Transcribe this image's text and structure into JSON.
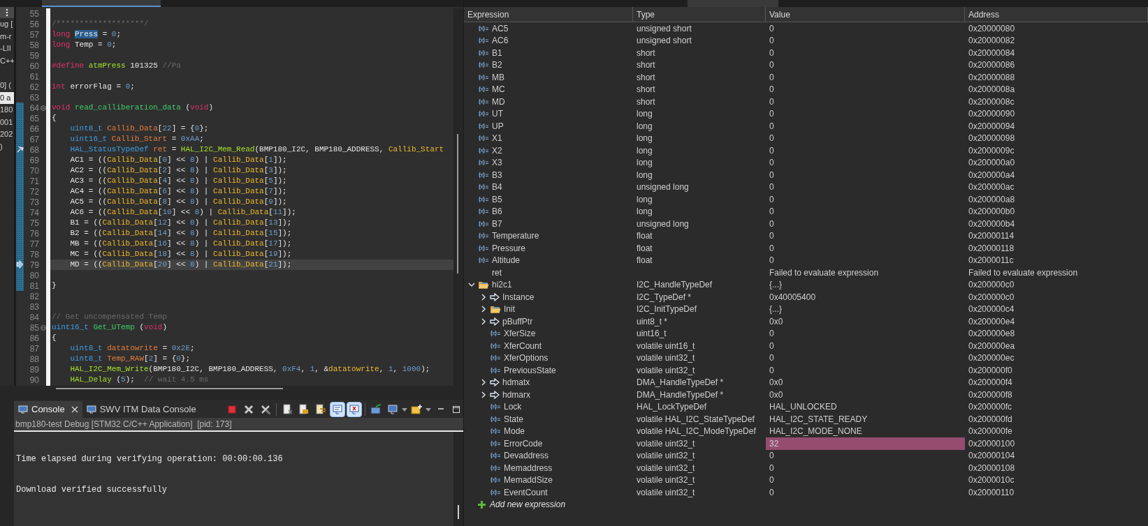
{
  "left_panel": {
    "fragments": [
      {
        "text": "ug [",
        "selected": false
      },
      {
        "text": "m-r",
        "selected": false
      },
      {
        "text": "-LII",
        "selected": false
      },
      {
        "text": "C++",
        "selected": false
      },
      {
        "text": "0] (",
        "selected": false
      },
      {
        "text": "0 a",
        "selected": true
      },
      {
        "text": "180",
        "selected": false
      },
      {
        "text": "001",
        "selected": false
      },
      {
        "text": "202",
        "selected": false
      },
      {
        "text": ")",
        "selected": false
      }
    ]
  },
  "editor": {
    "lines": [
      {
        "number": "55",
        "kind": "code",
        "current": false,
        "ranged": false,
        "foldable": false,
        "indented": false
      },
      {
        "number": "56",
        "kind": "code",
        "current": false,
        "ranged": false,
        "foldable": false,
        "indented": false,
        "tokens": [
          {
            "kind": "comment",
            "text": "/*******************/"
          }
        ]
      },
      {
        "number": "57",
        "kind": "code",
        "current": false,
        "ranged": false,
        "foldable": false,
        "indented": false,
        "tokens": [
          {
            "kind": "kw",
            "text": "long "
          },
          {
            "kind": "sel",
            "text": "Press"
          },
          {
            "kind": "plain",
            "text": " = "
          },
          {
            "kind": "num",
            "text": "0"
          },
          {
            "kind": "plain",
            "text": ";"
          }
        ]
      },
      {
        "number": "58",
        "kind": "code",
        "current": false,
        "ranged": false,
        "foldable": false,
        "indented": false,
        "tokens": [
          {
            "kind": "kw",
            "text": "long"
          },
          {
            "kind": "plain",
            "text": " Temp = "
          },
          {
            "kind": "num",
            "text": "0"
          },
          {
            "kind": "plain",
            "text": ";"
          }
        ]
      },
      {
        "number": "59",
        "kind": "code",
        "current": false,
        "ranged": false,
        "foldable": false,
        "indented": false
      },
      {
        "number": "60",
        "kind": "code",
        "current": false,
        "ranged": false,
        "foldable": false,
        "indented": false,
        "tokens": [
          {
            "kind": "kw",
            "text": "#define "
          },
          {
            "kind": "macro",
            "text": "atmPress"
          },
          {
            "kind": "plain",
            "text": " 101325 "
          },
          {
            "kind": "comment",
            "text": "//Pa"
          }
        ]
      },
      {
        "number": "61",
        "kind": "code",
        "current": false,
        "ranged": false,
        "foldable": false,
        "indented": false
      },
      {
        "number": "62",
        "kind": "code",
        "current": false,
        "ranged": false,
        "foldable": false,
        "indented": false,
        "tokens": [
          {
            "kind": "kw",
            "text": "int"
          },
          {
            "kind": "plain",
            "text": " errorFlag = "
          },
          {
            "kind": "num",
            "text": "0"
          },
          {
            "kind": "plain",
            "text": ";"
          }
        ]
      },
      {
        "number": "63",
        "kind": "code",
        "current": false,
        "ranged": false,
        "foldable": false,
        "indented": false
      },
      {
        "number": "64",
        "kind": "code",
        "current": false,
        "ranged": true,
        "foldable": true,
        "indented": false,
        "tokens": [
          {
            "kind": "kw",
            "text": "void "
          },
          {
            "kind": "fdecl",
            "text": "read_calliberation_data"
          },
          {
            "kind": "plain",
            "text": " ("
          },
          {
            "kind": "kw",
            "text": "void"
          },
          {
            "kind": "plain",
            "text": ")"
          }
        ]
      },
      {
        "number": "65",
        "kind": "code",
        "current": false,
        "ranged": true,
        "foldable": false,
        "indented": false,
        "tokens": [
          {
            "kind": "plain",
            "text": "{"
          }
        ]
      },
      {
        "number": "66",
        "kind": "code",
        "current": false,
        "ranged": true,
        "foldable": false,
        "indented": true,
        "tokens": [
          {
            "kind": "type",
            "text": "uint8_t "
          },
          {
            "kind": "local",
            "text": "Callib_Data"
          },
          {
            "kind": "plain",
            "text": "["
          },
          {
            "kind": "num",
            "text": "22"
          },
          {
            "kind": "plain",
            "text": "] = {"
          },
          {
            "kind": "num",
            "text": "0"
          },
          {
            "kind": "plain",
            "text": "};"
          }
        ]
      },
      {
        "number": "67",
        "kind": "code",
        "current": false,
        "ranged": true,
        "foldable": false,
        "indented": true,
        "tokens": [
          {
            "kind": "type",
            "text": "uint16_t "
          },
          {
            "kind": "local",
            "text": "Callib_Start"
          },
          {
            "kind": "plain",
            "text": " = "
          },
          {
            "kind": "num",
            "text": "0xAA"
          },
          {
            "kind": "plain",
            "text": ";"
          }
        ]
      },
      {
        "number": "68",
        "kind": "breakpoint",
        "current": false,
        "ranged": true,
        "foldable": false,
        "indented": true,
        "tokens": [
          {
            "kind": "type",
            "text": "HAL_StatusTypeDef "
          },
          {
            "kind": "local",
            "text": "ret"
          },
          {
            "kind": "plain",
            "text": " = "
          },
          {
            "kind": "func",
            "text": "HAL_I2C_Mem_Read"
          },
          {
            "kind": "plain",
            "text": "(BMP180_I2C, BMP180_ADDRESS, "
          },
          {
            "kind": "var",
            "text": "Callib_Start"
          }
        ]
      },
      {
        "number": "69",
        "kind": "code",
        "current": false,
        "ranged": true,
        "foldable": false,
        "indented": true,
        "tokens": [
          {
            "kind": "plain",
            "text": "AC1 = (("
          },
          {
            "kind": "var",
            "text": "Callib_Data"
          },
          {
            "kind": "plain",
            "text": "["
          },
          {
            "kind": "num",
            "text": "0"
          },
          {
            "kind": "plain",
            "text": "] << "
          },
          {
            "kind": "num",
            "text": "8"
          },
          {
            "kind": "plain",
            "text": ") | "
          },
          {
            "kind": "var",
            "text": "Callib_Data"
          },
          {
            "kind": "plain",
            "text": "["
          },
          {
            "kind": "num",
            "text": "1"
          },
          {
            "kind": "plain",
            "text": "]);"
          }
        ]
      },
      {
        "number": "70",
        "kind": "code",
        "current": false,
        "ranged": true,
        "foldable": false,
        "indented": true,
        "tokens": [
          {
            "kind": "plain",
            "text": "AC2 = (("
          },
          {
            "kind": "var",
            "text": "Callib_Data"
          },
          {
            "kind": "plain",
            "text": "["
          },
          {
            "kind": "num",
            "text": "2"
          },
          {
            "kind": "plain",
            "text": "] << "
          },
          {
            "kind": "num",
            "text": "8"
          },
          {
            "kind": "plain",
            "text": ") | "
          },
          {
            "kind": "var",
            "text": "Callib_Data"
          },
          {
            "kind": "plain",
            "text": "["
          },
          {
            "kind": "num",
            "text": "3"
          },
          {
            "kind": "plain",
            "text": "]);"
          }
        ]
      },
      {
        "number": "71",
        "kind": "code",
        "current": false,
        "ranged": true,
        "foldable": false,
        "indented": true,
        "tokens": [
          {
            "kind": "plain",
            "text": "AC3 = (("
          },
          {
            "kind": "var",
            "text": "Callib_Data"
          },
          {
            "kind": "plain",
            "text": "["
          },
          {
            "kind": "num",
            "text": "4"
          },
          {
            "kind": "plain",
            "text": "] << "
          },
          {
            "kind": "num",
            "text": "8"
          },
          {
            "kind": "plain",
            "text": ") | "
          },
          {
            "kind": "var",
            "text": "Callib_Data"
          },
          {
            "kind": "plain",
            "text": "["
          },
          {
            "kind": "num",
            "text": "5"
          },
          {
            "kind": "plain",
            "text": "]);"
          }
        ]
      },
      {
        "number": "72",
        "kind": "code",
        "current": false,
        "ranged": true,
        "foldable": false,
        "indented": true,
        "tokens": [
          {
            "kind": "plain",
            "text": "AC4 = (("
          },
          {
            "kind": "var",
            "text": "Callib_Data"
          },
          {
            "kind": "plain",
            "text": "["
          },
          {
            "kind": "num",
            "text": "6"
          },
          {
            "kind": "plain",
            "text": "] << "
          },
          {
            "kind": "num",
            "text": "8"
          },
          {
            "kind": "plain",
            "text": ") | "
          },
          {
            "kind": "var",
            "text": "Callib_Data"
          },
          {
            "kind": "plain",
            "text": "["
          },
          {
            "kind": "num",
            "text": "7"
          },
          {
            "kind": "plain",
            "text": "]);"
          }
        ]
      },
      {
        "number": "73",
        "kind": "code",
        "current": false,
        "ranged": true,
        "foldable": false,
        "indented": true,
        "tokens": [
          {
            "kind": "plain",
            "text": "AC5 = (("
          },
          {
            "kind": "var",
            "text": "Callib_Data"
          },
          {
            "kind": "plain",
            "text": "["
          },
          {
            "kind": "num",
            "text": "8"
          },
          {
            "kind": "plain",
            "text": "] << "
          },
          {
            "kind": "num",
            "text": "8"
          },
          {
            "kind": "plain",
            "text": ") | "
          },
          {
            "kind": "var",
            "text": "Callib_Data"
          },
          {
            "kind": "plain",
            "text": "["
          },
          {
            "kind": "num",
            "text": "9"
          },
          {
            "kind": "plain",
            "text": "]);"
          }
        ]
      },
      {
        "number": "74",
        "kind": "code",
        "current": false,
        "ranged": true,
        "foldable": false,
        "indented": true,
        "tokens": [
          {
            "kind": "plain",
            "text": "AC6 = (("
          },
          {
            "kind": "var",
            "text": "Callib_Data"
          },
          {
            "kind": "plain",
            "text": "["
          },
          {
            "kind": "num",
            "text": "10"
          },
          {
            "kind": "plain",
            "text": "] << "
          },
          {
            "kind": "num",
            "text": "8"
          },
          {
            "kind": "plain",
            "text": ") | "
          },
          {
            "kind": "var",
            "text": "Callib_Data"
          },
          {
            "kind": "plain",
            "text": "["
          },
          {
            "kind": "num",
            "text": "11"
          },
          {
            "kind": "plain",
            "text": "]);"
          }
        ]
      },
      {
        "number": "75",
        "kind": "code",
        "current": false,
        "ranged": true,
        "foldable": false,
        "indented": true,
        "tokens": [
          {
            "kind": "plain",
            "text": "B1 = (("
          },
          {
            "kind": "var",
            "text": "Callib_Data"
          },
          {
            "kind": "plain",
            "text": "["
          },
          {
            "kind": "num",
            "text": "12"
          },
          {
            "kind": "plain",
            "text": "] << "
          },
          {
            "kind": "num",
            "text": "8"
          },
          {
            "kind": "plain",
            "text": ") | "
          },
          {
            "kind": "var",
            "text": "Callib_Data"
          },
          {
            "kind": "plain",
            "text": "["
          },
          {
            "kind": "num",
            "text": "13"
          },
          {
            "kind": "plain",
            "text": "]);"
          }
        ]
      },
      {
        "number": "76",
        "kind": "code",
        "current": false,
        "ranged": true,
        "foldable": false,
        "indented": true,
        "tokens": [
          {
            "kind": "plain",
            "text": "B2 = (("
          },
          {
            "kind": "var",
            "text": "Callib_Data"
          },
          {
            "kind": "plain",
            "text": "["
          },
          {
            "kind": "num",
            "text": "14"
          },
          {
            "kind": "plain",
            "text": "] << "
          },
          {
            "kind": "num",
            "text": "8"
          },
          {
            "kind": "plain",
            "text": ") | "
          },
          {
            "kind": "var",
            "text": "Callib_Data"
          },
          {
            "kind": "plain",
            "text": "["
          },
          {
            "kind": "num",
            "text": "15"
          },
          {
            "kind": "plain",
            "text": "]);"
          }
        ]
      },
      {
        "number": "77",
        "kind": "code",
        "current": false,
        "ranged": true,
        "foldable": false,
        "indented": true,
        "tokens": [
          {
            "kind": "plain",
            "text": "MB = (("
          },
          {
            "kind": "var",
            "text": "Callib_Data"
          },
          {
            "kind": "plain",
            "text": "["
          },
          {
            "kind": "num",
            "text": "16"
          },
          {
            "kind": "plain",
            "text": "] << "
          },
          {
            "kind": "num",
            "text": "8"
          },
          {
            "kind": "plain",
            "text": ") | "
          },
          {
            "kind": "var",
            "text": "Callib_Data"
          },
          {
            "kind": "plain",
            "text": "["
          },
          {
            "kind": "num",
            "text": "17"
          },
          {
            "kind": "plain",
            "text": "]);"
          }
        ]
      },
      {
        "number": "78",
        "kind": "code",
        "current": false,
        "ranged": true,
        "foldable": false,
        "indented": true,
        "tokens": [
          {
            "kind": "plain",
            "text": "MC = (("
          },
          {
            "kind": "var",
            "text": "Callib_Data"
          },
          {
            "kind": "plain",
            "text": "["
          },
          {
            "kind": "num",
            "text": "18"
          },
          {
            "kind": "plain",
            "text": "] << "
          },
          {
            "kind": "num",
            "text": "8"
          },
          {
            "kind": "plain",
            "text": ") | "
          },
          {
            "kind": "var",
            "text": "Callib_Data"
          },
          {
            "kind": "plain",
            "text": "["
          },
          {
            "kind": "num",
            "text": "19"
          },
          {
            "kind": "plain",
            "text": "]);"
          }
        ]
      },
      {
        "number": "79",
        "kind": "pointer",
        "current": true,
        "ranged": true,
        "foldable": false,
        "indented": true,
        "tokens": [
          {
            "kind": "plain",
            "text": "MD = (("
          },
          {
            "kind": "var",
            "text": "Callib_Data"
          },
          {
            "kind": "plain",
            "text": "["
          },
          {
            "kind": "num",
            "text": "20"
          },
          {
            "kind": "plain",
            "text": "] << "
          },
          {
            "kind": "num",
            "text": "8"
          },
          {
            "kind": "plain",
            "text": ") | "
          },
          {
            "kind": "var",
            "text": "Callib_Data"
          },
          {
            "kind": "plain",
            "text": "["
          },
          {
            "kind": "num",
            "text": "21"
          },
          {
            "kind": "plain",
            "text": "]);"
          }
        ]
      },
      {
        "number": "80",
        "kind": "code",
        "current": false,
        "ranged": true,
        "foldable": false,
        "indented": false
      },
      {
        "number": "81",
        "kind": "code",
        "current": false,
        "ranged": true,
        "foldable": false,
        "indented": false,
        "tokens": [
          {
            "kind": "plain",
            "text": "}"
          }
        ]
      },
      {
        "number": "82",
        "kind": "code",
        "current": false,
        "ranged": false,
        "foldable": false,
        "indented": false
      },
      {
        "number": "83",
        "kind": "code",
        "current": false,
        "ranged": false,
        "foldable": false,
        "indented": false
      },
      {
        "number": "84",
        "kind": "code",
        "current": false,
        "ranged": false,
        "foldable": false,
        "indented": false,
        "tokens": [
          {
            "kind": "comment",
            "text": "// Get uncompensated Temp"
          }
        ]
      },
      {
        "number": "85",
        "kind": "code",
        "current": false,
        "ranged": false,
        "foldable": true,
        "indented": false,
        "tokens": [
          {
            "kind": "type",
            "text": "uint16_t "
          },
          {
            "kind": "fdecl",
            "text": "Get_UTemp"
          },
          {
            "kind": "plain",
            "text": " ("
          },
          {
            "kind": "kw",
            "text": "void"
          },
          {
            "kind": "plain",
            "text": ")"
          }
        ]
      },
      {
        "number": "86",
        "kind": "code",
        "current": false,
        "ranged": false,
        "foldable": false,
        "indented": false,
        "tokens": [
          {
            "kind": "plain",
            "text": "{"
          }
        ]
      },
      {
        "number": "87",
        "kind": "code",
        "current": false,
        "ranged": false,
        "foldable": false,
        "indented": true,
        "tokens": [
          {
            "kind": "type",
            "text": "uint8_t "
          },
          {
            "kind": "local",
            "text": "datatowrite"
          },
          {
            "kind": "plain",
            "text": " = "
          },
          {
            "kind": "num",
            "text": "0x2E"
          },
          {
            "kind": "plain",
            "text": ";"
          }
        ]
      },
      {
        "number": "88",
        "kind": "code",
        "current": false,
        "ranged": false,
        "foldable": false,
        "indented": true,
        "tokens": [
          {
            "kind": "type",
            "text": "uint8_t "
          },
          {
            "kind": "local",
            "text": "Temp_RAW"
          },
          {
            "kind": "plain",
            "text": "["
          },
          {
            "kind": "num",
            "text": "2"
          },
          {
            "kind": "plain",
            "text": "] = {"
          },
          {
            "kind": "num",
            "text": "0"
          },
          {
            "kind": "plain",
            "text": "};"
          }
        ]
      },
      {
        "number": "89",
        "kind": "code",
        "current": false,
        "ranged": false,
        "foldable": false,
        "indented": true,
        "tokens": [
          {
            "kind": "func",
            "text": "HAL_I2C_Mem_Write"
          },
          {
            "kind": "plain",
            "text": "(BMP180_I2C, BMP180_ADDRESS, "
          },
          {
            "kind": "num",
            "text": "0xF4"
          },
          {
            "kind": "plain",
            "text": ", "
          },
          {
            "kind": "num",
            "text": "1"
          },
          {
            "kind": "plain",
            "text": ", &"
          },
          {
            "kind": "var",
            "text": "datatowrite"
          },
          {
            "kind": "plain",
            "text": ", "
          },
          {
            "kind": "num",
            "text": "1"
          },
          {
            "kind": "plain",
            "text": ", "
          },
          {
            "kind": "num",
            "text": "1000"
          },
          {
            "kind": "plain",
            "text": ");"
          }
        ]
      },
      {
        "number": "90",
        "kind": "code",
        "current": false,
        "ranged": false,
        "foldable": false,
        "indented": true,
        "tokens": [
          {
            "kind": "func",
            "text": "HAL_Delay"
          },
          {
            "kind": "plain",
            "text": " ("
          },
          {
            "kind": "num",
            "text": "5"
          },
          {
            "kind": "plain",
            "text": ");  "
          },
          {
            "kind": "comment",
            "text": "// wait 4.5 ms"
          }
        ]
      }
    ]
  },
  "console": {
    "tabs": [
      {
        "label": "Console",
        "selected": true
      },
      {
        "label": "SWV ITM Data Console",
        "selected": false
      }
    ],
    "toolbar": [
      {
        "kind": "terminate",
        "on": false
      },
      {
        "kind": "remove",
        "on": false
      },
      {
        "kind": "remove-all",
        "on": false
      },
      {
        "kind": "clear",
        "on": false
      },
      {
        "kind": "scroll-lock",
        "on": false
      },
      {
        "kind": "word-wrap",
        "on": false
      },
      {
        "kind": "show-stdout",
        "on": true
      },
      {
        "kind": "show-stderr",
        "on": true
      },
      {
        "kind": "pin",
        "on": false
      },
      {
        "kind": "display",
        "on": false
      },
      {
        "kind": "new-console",
        "on": false
      }
    ],
    "launch": "bmp180-test Debug [STM32 C/C++ Application]  [pid: 173]",
    "lines": [
      "Time elapsed during verifying operation: 00:00:00.136",
      "Download verified successfully"
    ]
  },
  "expressions": {
    "columns": [
      "Expression",
      "Type",
      "Value",
      "Address"
    ],
    "rows": [
      {
        "expression": "AC5",
        "type": "unsigned short",
        "value": "0",
        "address": "0x20000080",
        "kind": "variable",
        "changed": false
      },
      {
        "expression": "AC6",
        "type": "unsigned short",
        "value": "0",
        "address": "0x20000082",
        "kind": "variable",
        "changed": false
      },
      {
        "expression": "B1",
        "type": "short",
        "value": "0",
        "address": "0x20000084",
        "kind": "variable",
        "changed": false
      },
      {
        "expression": "B2",
        "type": "short",
        "value": "0",
        "address": "0x20000086",
        "kind": "variable",
        "changed": false
      },
      {
        "expression": "MB",
        "type": "short",
        "value": "0",
        "address": "0x20000088",
        "kind": "variable",
        "changed": false
      },
      {
        "expression": "MC",
        "type": "short",
        "value": "0",
        "address": "0x2000008a",
        "kind": "variable",
        "changed": false
      },
      {
        "expression": "MD",
        "type": "short",
        "value": "0",
        "address": "0x2000008c",
        "kind": "variable",
        "changed": false
      },
      {
        "expression": "UT",
        "type": "long",
        "value": "0",
        "address": "0x20000090",
        "kind": "variable",
        "changed": false
      },
      {
        "expression": "UP",
        "type": "long",
        "value": "0",
        "address": "0x20000094",
        "kind": "variable",
        "changed": false
      },
      {
        "expression": "X1",
        "type": "long",
        "value": "0",
        "address": "0x20000098",
        "kind": "variable",
        "changed": false
      },
      {
        "expression": "X2",
        "type": "long",
        "value": "0",
        "address": "0x2000009c",
        "kind": "variable",
        "changed": false
      },
      {
        "expression": "X3",
        "type": "long",
        "value": "0",
        "address": "0x200000a0",
        "kind": "variable",
        "changed": false
      },
      {
        "expression": "B3",
        "type": "long",
        "value": "0",
        "address": "0x200000a4",
        "kind": "variable",
        "changed": false
      },
      {
        "expression": "B4",
        "type": "unsigned long",
        "value": "0",
        "address": "0x200000ac",
        "kind": "variable",
        "changed": false
      },
      {
        "expression": "B5",
        "type": "long",
        "value": "0",
        "address": "0x200000a8",
        "kind": "variable",
        "changed": false
      },
      {
        "expression": "B6",
        "type": "long",
        "value": "0",
        "address": "0x200000b0",
        "kind": "variable",
        "changed": false
      },
      {
        "expression": "B7",
        "type": "unsigned long",
        "value": "0",
        "address": "0x200000b4",
        "kind": "variable",
        "changed": false
      },
      {
        "expression": "Temperature",
        "type": "float",
        "value": "0",
        "address": "0x20000114",
        "kind": "variable",
        "changed": false
      },
      {
        "expression": "Pressure",
        "type": "float",
        "value": "0",
        "address": "0x20000118",
        "kind": "variable",
        "changed": false
      },
      {
        "expression": "Altitude",
        "type": "float",
        "value": "0",
        "address": "0x2000011c",
        "kind": "variable",
        "changed": false
      },
      {
        "expression": "ret",
        "value": "Failed to evaluate expression",
        "address": "Failed to evaluate expression",
        "kind": "error",
        "changed": false
      },
      {
        "expression": "hi2c1",
        "type": "I2C_HandleTypeDef",
        "value": "{...}",
        "address": "0x200000c0",
        "kind": "struct",
        "changed": false,
        "expanded": true,
        "children": [
          {
            "expression": "Instance",
            "type": "I2C_TypeDef *",
            "value": "0x40005400",
            "address": "0x200000c0",
            "kind": "pointer",
            "changed": false,
            "expanded": false
          },
          {
            "expression": "Init",
            "type": "I2C_InitTypeDef",
            "value": "{...}",
            "address": "0x200000c4",
            "kind": "struct",
            "changed": false,
            "expanded": false
          },
          {
            "expression": "pBuffPtr",
            "type": "uint8_t *",
            "value": "0x0",
            "address": "0x200000e4",
            "kind": "pointer",
            "changed": false,
            "expanded": false
          },
          {
            "expression": "XferSize",
            "type": "uint16_t",
            "value": "0",
            "address": "0x200000e8",
            "kind": "variable",
            "changed": false
          },
          {
            "expression": "XferCount",
            "type": "volatile uint16_t",
            "value": "0",
            "address": "0x200000ea",
            "kind": "variable",
            "changed": false
          },
          {
            "expression": "XferOptions",
            "type": "volatile uint32_t",
            "value": "0",
            "address": "0x200000ec",
            "kind": "variable",
            "changed": false
          },
          {
            "expression": "PreviousState",
            "type": "volatile uint32_t",
            "value": "0",
            "address": "0x200000f0",
            "kind": "variable",
            "changed": false
          },
          {
            "expression": "hdmatx",
            "type": "DMA_HandleTypeDef *",
            "value": "0x0",
            "address": "0x200000f4",
            "kind": "pointer",
            "changed": false,
            "expanded": false
          },
          {
            "expression": "hdmarx",
            "type": "DMA_HandleTypeDef *",
            "value": "0x0",
            "address": "0x200000f8",
            "kind": "pointer",
            "changed": false,
            "expanded": false
          },
          {
            "expression": "Lock",
            "type": "HAL_LockTypeDef",
            "value": "HAL_UNLOCKED",
            "address": "0x200000fc",
            "kind": "variable",
            "changed": false
          },
          {
            "expression": "State",
            "type": "volatile HAL_I2C_StateTypeDef",
            "value": "HAL_I2C_STATE_READY",
            "address": "0x200000fd",
            "kind": "variable",
            "changed": false
          },
          {
            "expression": "Mode",
            "type": "volatile HAL_I2C_ModeTypeDef",
            "value": "HAL_I2C_MODE_NONE",
            "address": "0x200000fe",
            "kind": "variable",
            "changed": false
          },
          {
            "expression": "ErrorCode",
            "type": "volatile uint32_t",
            "value": "32",
            "address": "0x20000100",
            "kind": "variable",
            "changed": true
          },
          {
            "expression": "Devaddress",
            "type": "volatile uint32_t",
            "value": "0",
            "address": "0x20000104",
            "kind": "variable",
            "changed": false
          },
          {
            "expression": "Memaddress",
            "type": "volatile uint32_t",
            "value": "0",
            "address": "0x20000108",
            "kind": "variable",
            "changed": false
          },
          {
            "expression": "MemaddSize",
            "type": "volatile uint32_t",
            "value": "0",
            "address": "0x2000010c",
            "kind": "variable",
            "changed": false
          },
          {
            "expression": "EventCount",
            "type": "volatile uint32_t",
            "value": "0",
            "address": "0x20000110",
            "kind": "variable",
            "changed": false
          }
        ]
      }
    ],
    "add_label": "Add new expression"
  }
}
